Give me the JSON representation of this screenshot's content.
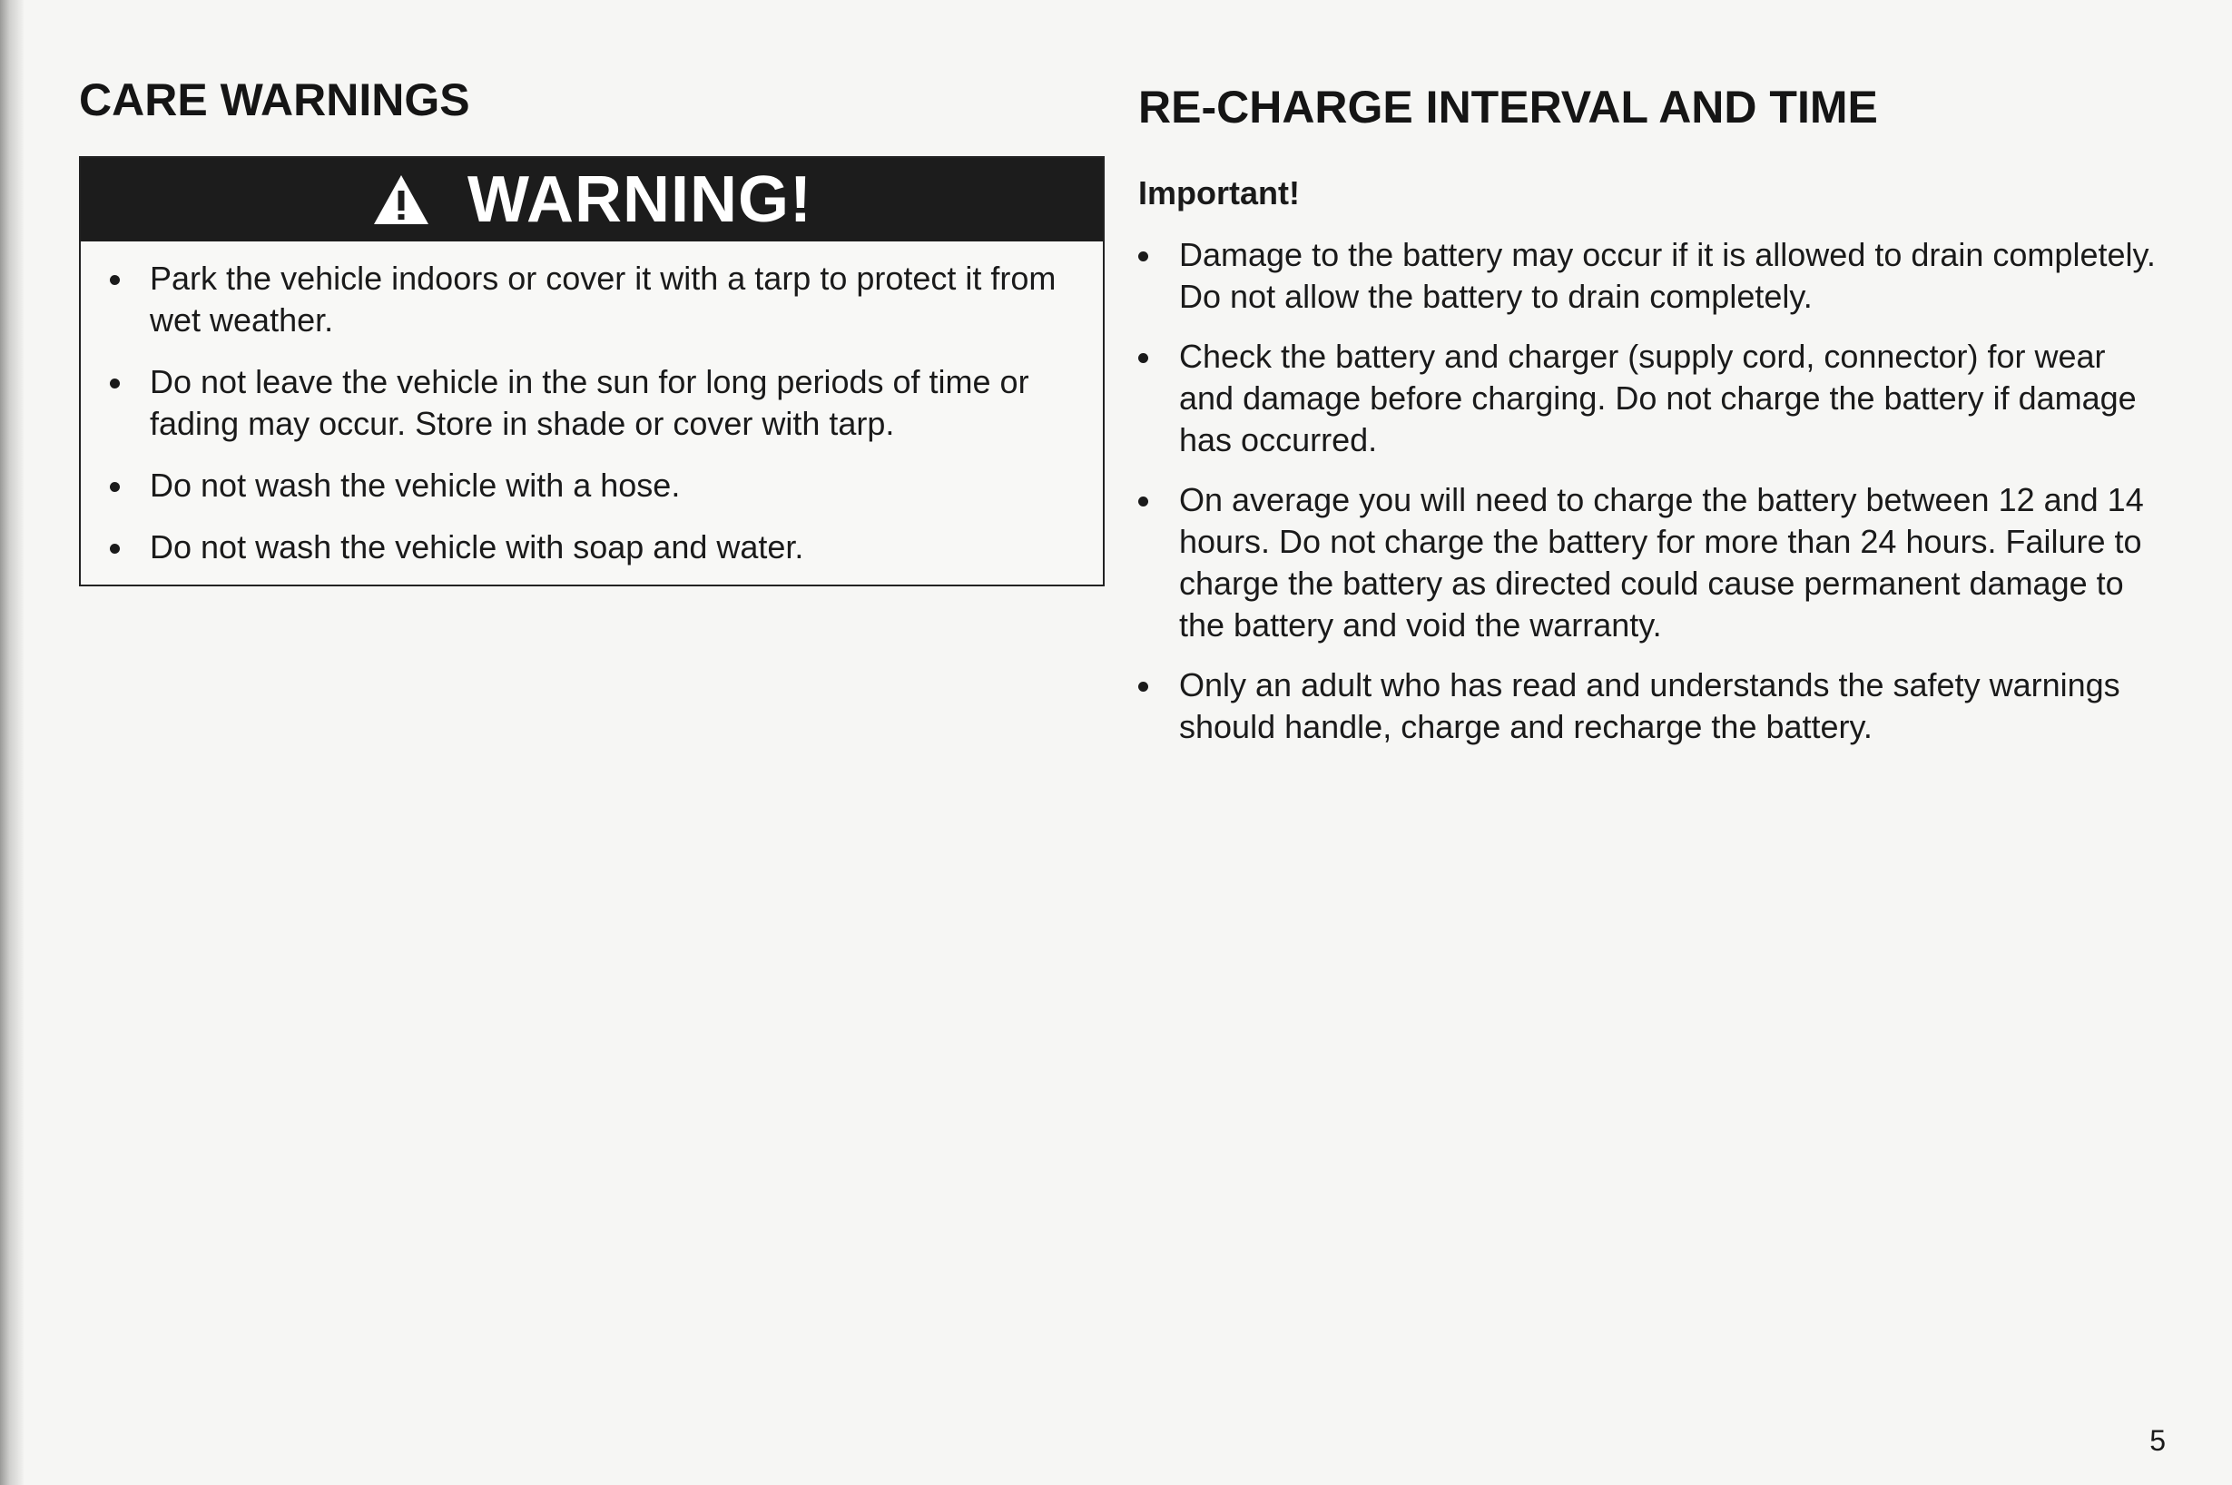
{
  "left_section": {
    "title": "CARE WARNINGS",
    "warning_box": {
      "icon": "warning-triangle-icon",
      "heading": "WARNING!",
      "items": [
        "Park the vehicle indoors or cover it with a tarp to protect it from wet weather.",
        "Do not leave the vehicle in the sun for long periods of time or fading may occur.  Store in shade or cover with tarp.",
        "Do not wash the vehicle with a hose.",
        "Do not wash the vehicle with soap and water."
      ]
    }
  },
  "right_section": {
    "title": "RE-CHARGE INTERVAL AND TIME",
    "important_label": "Important!",
    "items": [
      "Damage to the battery may occur if it is allowed to drain completely. Do not allow the battery to drain completely.",
      "Check the battery and charger (supply cord, connector) for wear and damage before charging. Do not charge the battery if damage has occurred.",
      "On average you will need to charge the battery between 12 and 14 hours. Do not charge the battery for more than 24 hours. Failure to charge the battery as directed could cause permanent damage to the battery and void the warranty.",
      "Only an adult who has read and understands the safety warnings should handle, charge and recharge the battery."
    ]
  },
  "page_number": "5"
}
